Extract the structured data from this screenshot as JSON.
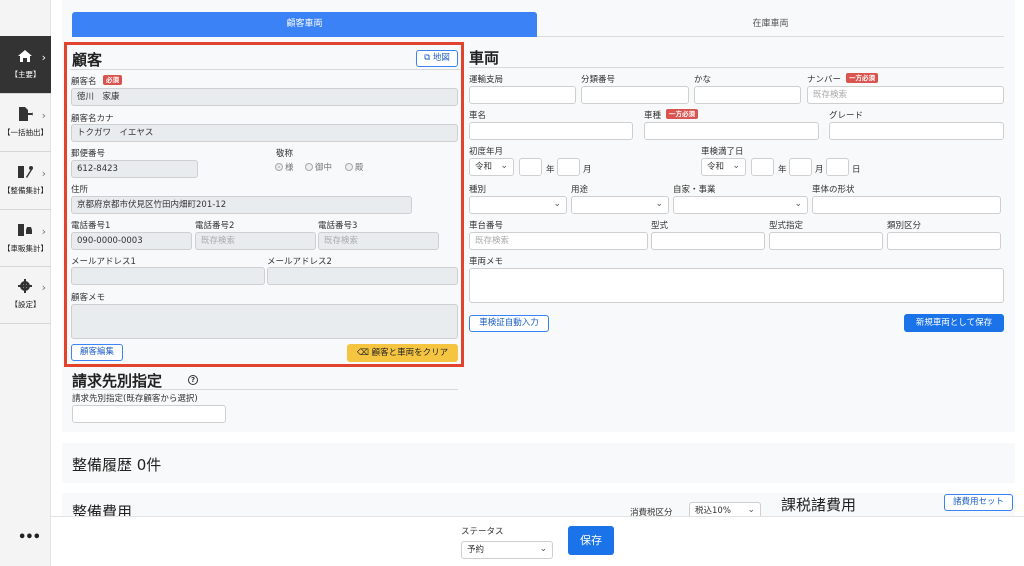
{
  "sidebar": {
    "items": [
      {
        "label": "【主要】",
        "icon": "home-icon",
        "active": true
      },
      {
        "label": "【一括抽出】",
        "icon": "file-export-icon",
        "active": false
      },
      {
        "label": "【整備集計】",
        "icon": "wrench-doc-icon",
        "active": false
      },
      {
        "label": "【車販集計】",
        "icon": "car-doc-icon",
        "active": false
      },
      {
        "label": "【設定】",
        "icon": "gear-icon",
        "active": false
      }
    ],
    "more_label": "•••"
  },
  "tabs": [
    "顧客車両",
    "在庫車両"
  ],
  "customer": {
    "title": "顧客",
    "map_button": "地図",
    "name_label": "顧客名",
    "required": "必須",
    "name_value": "徳川　家康",
    "kana_label": "顧客名カナ",
    "kana_value": "トクガワ　イエヤス",
    "zip_label": "郵便番号",
    "zip_value": "612-8423",
    "honorific_label": "敬称",
    "honorifics": [
      "様",
      "御中",
      "殿"
    ],
    "address_label": "住所",
    "address_value": "京都府京都市伏見区竹田内畑町201-12",
    "phone1_label": "電話番号1",
    "phone1_value": "090-0000-0003",
    "phone2_label": "電話番号2",
    "phone2_placeholder": "既存検索",
    "phone3_label": "電話番号3",
    "phone3_placeholder": "既存検索",
    "mail1_label": "メールアドレス1",
    "mail2_label": "メールアドレス2",
    "memo_label": "顧客メモ",
    "edit_button": "顧客編集",
    "clear_button": "顧客と車両をクリア"
  },
  "vehicle": {
    "title": "車両",
    "office_label": "運輸支局",
    "class_label": "分類番号",
    "kana_label": "かな",
    "number_label": "ナンバー",
    "either_required": "一方必須",
    "number_placeholder": "既存検索",
    "name_label": "車名",
    "type_label": "車種",
    "grade_label": "グレード",
    "first_reg_label": "初度年月",
    "era_value": "令和",
    "year_unit": "年",
    "month_unit": "月",
    "inspection_label": "車検満了日",
    "day_unit": "日",
    "kind_label": "種別",
    "use_label": "用途",
    "private_label": "自家・事業",
    "body_label": "車体の形状",
    "chassis_label": "車台番号",
    "chassis_placeholder": "既存検索",
    "model_label": "型式",
    "model_spec_label": "型式指定",
    "category_label": "類別区分",
    "memo_label": "車両メモ",
    "auto_input_button": "車検証自動入力",
    "save_new_button": "新規車両として保存"
  },
  "billing": {
    "title": "請求先別指定",
    "help": "?",
    "select_label": "請求先別指定(既存顧客から選択)"
  },
  "history": {
    "title": "整備履歴 0件"
  },
  "costs": {
    "title": "整備費用",
    "tax_label": "消費税区分",
    "tax_value": "税込10%",
    "taxable_title": "課税諸費用",
    "expense_set_button": "諸費用セット"
  },
  "footer": {
    "status_label": "ステータス",
    "status_value": "予約",
    "save_button": "保存"
  },
  "colors": {
    "accent": "#3b82f6",
    "highlight_border": "#e0442f",
    "warning": "#f5c542",
    "required": "#d9534f"
  }
}
